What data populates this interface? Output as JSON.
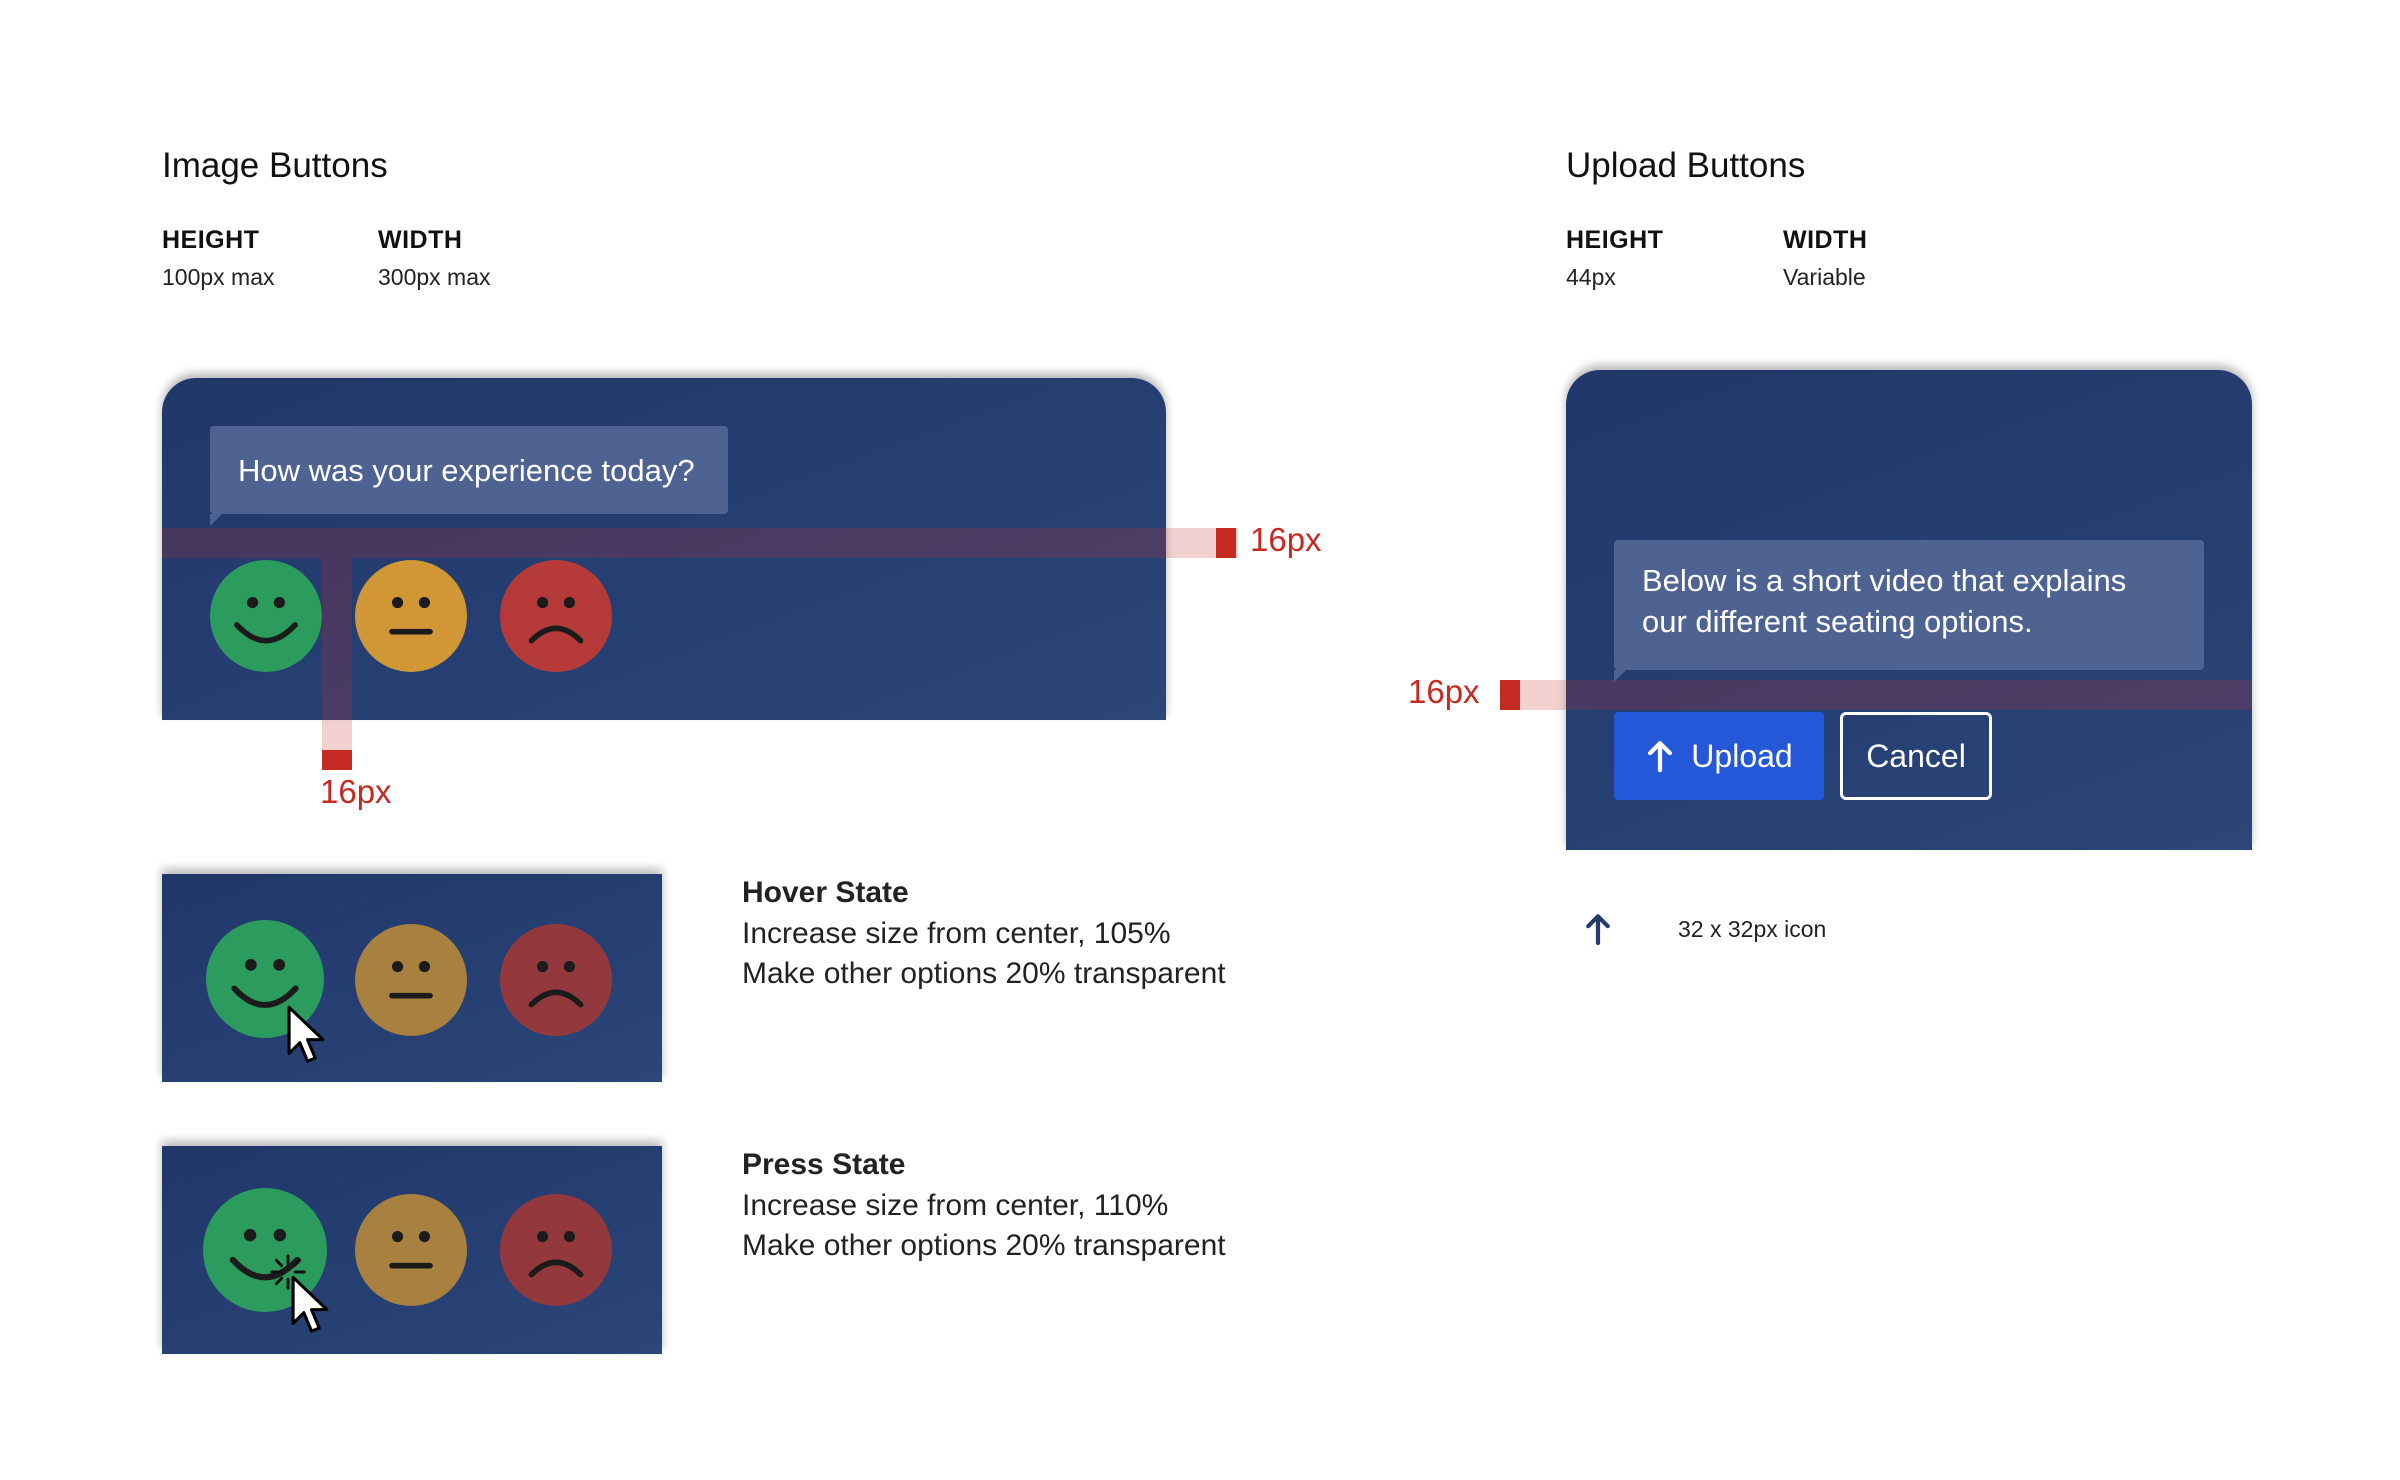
{
  "image_buttons": {
    "title": "Image Buttons",
    "height_label": "HEIGHT",
    "height_value": "100px max",
    "width_label": "WIDTH",
    "width_value": "300px max",
    "chat_prompt": "How was your experience today?",
    "measure_horizontal": "16px",
    "measure_vertical": "16px",
    "faces": [
      "happy-face-icon",
      "neutral-face-icon",
      "sad-face-icon"
    ]
  },
  "hover_state": {
    "title": "Hover State",
    "line1": "Increase size from center, 105%",
    "line2": "Make other options 20% transparent"
  },
  "press_state": {
    "title": "Press State",
    "line1": "Increase size from center, 110%",
    "line2": "Make other options 20% transparent"
  },
  "upload_buttons": {
    "title": "Upload Buttons",
    "height_label": "HEIGHT",
    "height_value": "44px",
    "width_label": "WIDTH",
    "width_value": "Variable",
    "chat_message": "Below is a short video that explains our different seating options.",
    "measure_label": "16px",
    "upload_label": "Upload",
    "cancel_label": "Cancel",
    "icon_spec": "32 x 32px icon"
  },
  "colors": {
    "panel": "#263f72",
    "bubble": "#4f6392",
    "upload_button": "#2558d8",
    "measure": "#c42a22",
    "happy": "#2b9c5e",
    "neutral": "#d19636",
    "sad": "#b73a3a"
  }
}
